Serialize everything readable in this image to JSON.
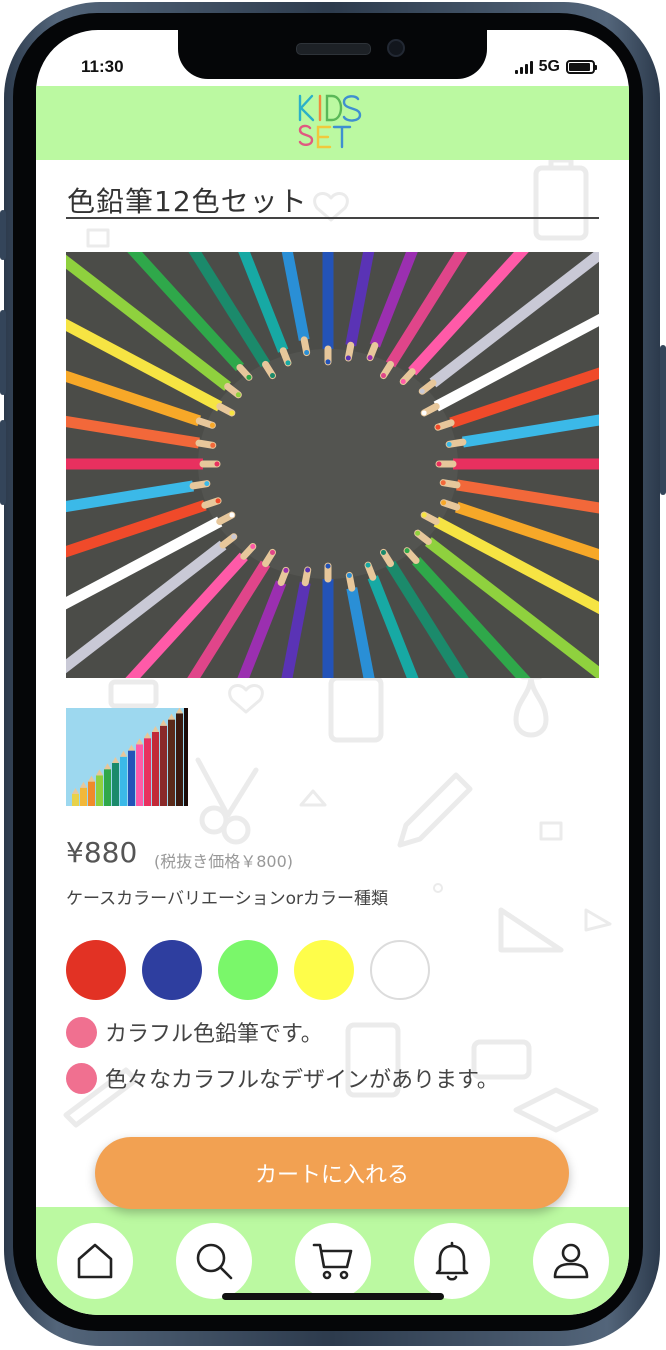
{
  "status_bar": {
    "time": "11:30",
    "network": "5G"
  },
  "header": {
    "logo_line1": "KIDS",
    "logo_line2": "SET"
  },
  "product": {
    "title": "色鉛筆12色セット",
    "price": "¥880",
    "tax_note": "(税抜き価格￥800)",
    "variation_label": "ケースカラーバリエーションorカラー種類",
    "swatches": [
      {
        "name": "red",
        "color": "#e23224"
      },
      {
        "name": "blue",
        "color": "#2e3e9f"
      },
      {
        "name": "green",
        "color": "#7af76a"
      },
      {
        "name": "yellow",
        "color": "#fefd4a"
      },
      {
        "name": "white",
        "color": "#ffffff"
      }
    ],
    "features": [
      "カラフル色鉛筆です。",
      "色々なカラフルなデザインがあります。"
    ]
  },
  "cart_button": {
    "label": "カートに入れる"
  },
  "tab_bar": {
    "items": [
      "home-icon",
      "search-icon",
      "cart-icon",
      "bell-icon",
      "user-icon"
    ]
  },
  "colors": {
    "header_bg": "#bbf9a1",
    "accent": "#f2a152",
    "bullet": "#f07090"
  }
}
